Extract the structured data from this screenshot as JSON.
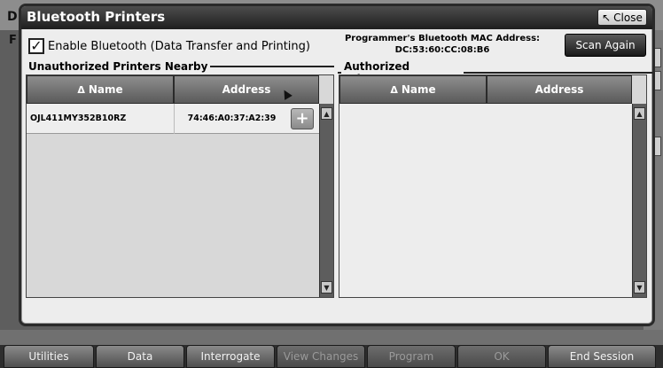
{
  "background": {
    "title_letter": "D",
    "sub_letter": "F"
  },
  "dialog": {
    "title": "Bluetooth Printers",
    "close_label": "Close",
    "enable_bluetooth": {
      "label": "Enable Bluetooth (Data Transfer and Printing)",
      "checked": true
    },
    "mac": {
      "label": "Programmer's Bluetooth MAC Address:",
      "value": "DC:53:60:CC:08:B6"
    },
    "scan_label": "Scan Again",
    "unauthorized": {
      "heading": "Unauthorized Printers Nearby",
      "columns": [
        "Name",
        "Address"
      ],
      "rows": [
        {
          "name": "OJL411MY352B10RZ",
          "address": "74:46:A0:37:A2:39"
        }
      ]
    },
    "authorized": {
      "heading": "Authorized Printers",
      "columns": [
        "Name",
        "Address"
      ],
      "rows": []
    }
  },
  "tabs": [
    {
      "label": "Utilities",
      "enabled": true
    },
    {
      "label": "Data",
      "enabled": true
    },
    {
      "label": "Interrogate",
      "enabled": true
    },
    {
      "label": "View Changes",
      "enabled": false
    },
    {
      "label": "Program",
      "enabled": false
    },
    {
      "label": "OK",
      "enabled": false
    },
    {
      "label": "End Session",
      "enabled": true
    }
  ],
  "icons": {
    "close": "close-arrow-icon",
    "sort": "sort-triangle-icon",
    "add": "plus-icon"
  }
}
